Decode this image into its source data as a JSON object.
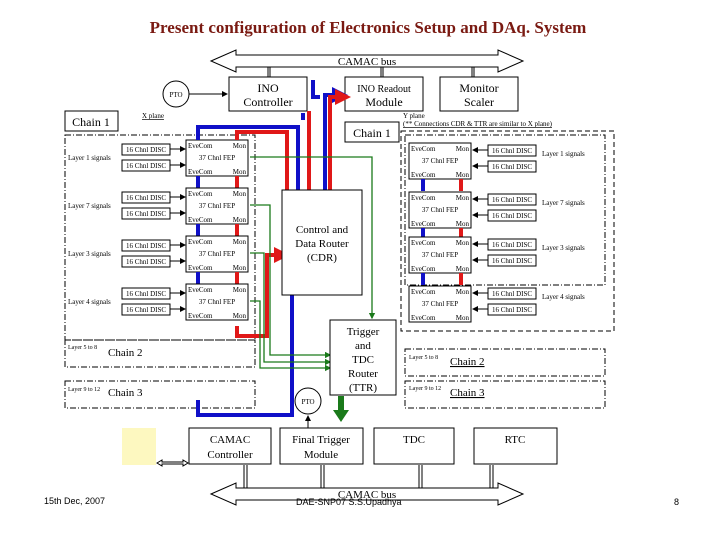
{
  "title": "Present configuration  of Electronics Setup and DAq. System",
  "top_bus": {
    "label": "CAMAC bus"
  },
  "bottom_bus": {
    "label": "CAMAC bus"
  },
  "top_modules": {
    "ino_controller": [
      "INO",
      "Controller"
    ],
    "ino_readout": [
      "INO Readout",
      "Module"
    ],
    "monitor_scaler": [
      "Monitor",
      "Scaler"
    ],
    "pto_top": "PTO"
  },
  "x_plane": {
    "plane_label": "X plane",
    "chain_label": "Chain 1",
    "layers": [
      {
        "label": "Layer 1 signals",
        "disc": [
          "16 Chnl DISC",
          "16 Chnl DISC"
        ]
      },
      {
        "label": "Layer 7 signals",
        "disc": [
          "16 Chnl DISC",
          "16 Chnl DISC"
        ]
      },
      {
        "label": "Layer 3 signals",
        "disc": [
          "16 Chnl DISC",
          "16 Chnl DISC"
        ]
      },
      {
        "label": "Layer 4 signals",
        "disc": [
          "16 Chnl DISC",
          "16 Chnl DISC"
        ]
      }
    ],
    "fep": {
      "top_left": "EveCom",
      "top_right": "Mon",
      "center": "37 Chnl FEP",
      "bottom_left": "EveCom",
      "bottom_right": "Mon"
    },
    "chain2": {
      "small": "Layer 5 to 8",
      "label": "Chain 2"
    },
    "chain3": {
      "small": "Layer 9 to 12",
      "label": "Chain 3"
    }
  },
  "y_plane": {
    "plane_label": "Y plane",
    "note": "(** Connections CDR & TTR are similar to X plane)",
    "chain_label": "Chain 1",
    "layers": [
      {
        "label": "Layer 1 signals",
        "disc": [
          "16 Chnl DISC",
          "16 Chnl DISC"
        ]
      },
      {
        "label": "Layer 7 signals",
        "disc": [
          "16 Chnl DISC",
          "16 Chnl DISC"
        ]
      },
      {
        "label": "Layer 3 signals",
        "disc": [
          "16 Chnl DISC",
          "16 Chnl DISC"
        ]
      },
      {
        "label": "Layer 4 signals",
        "disc": [
          "16 Chnl DISC",
          "16 Chnl DISC"
        ]
      }
    ],
    "chain2": {
      "small": "Layer 5 to 8",
      "label": "Chain 2"
    },
    "chain3": {
      "small": "Layer 9 to 12",
      "label": "Chain 3"
    }
  },
  "cdr": [
    "Control and",
    "Data Router",
    "(CDR)"
  ],
  "ttr": [
    "Trigger",
    "and",
    "TDC",
    "Router",
    "(TTR)"
  ],
  "pto_bottom": "PTO",
  "bottom_modules": {
    "camac_controller": [
      "CAMAC",
      "Controller"
    ],
    "final_trigger": [
      "Final Trigger",
      "Module"
    ],
    "tdc": "TDC",
    "rtc": "RTC"
  },
  "footer": {
    "date": "15th Dec, 2007",
    "center": "DAE-SNP07      S.S.Upadhya",
    "page": "8"
  },
  "colors": {
    "title": "#7a1a12",
    "event_line": "#1010c8",
    "monitor_line": "#e01818",
    "trigger_line": "#1a7a1a",
    "computer_block": "#fdf8c0"
  }
}
